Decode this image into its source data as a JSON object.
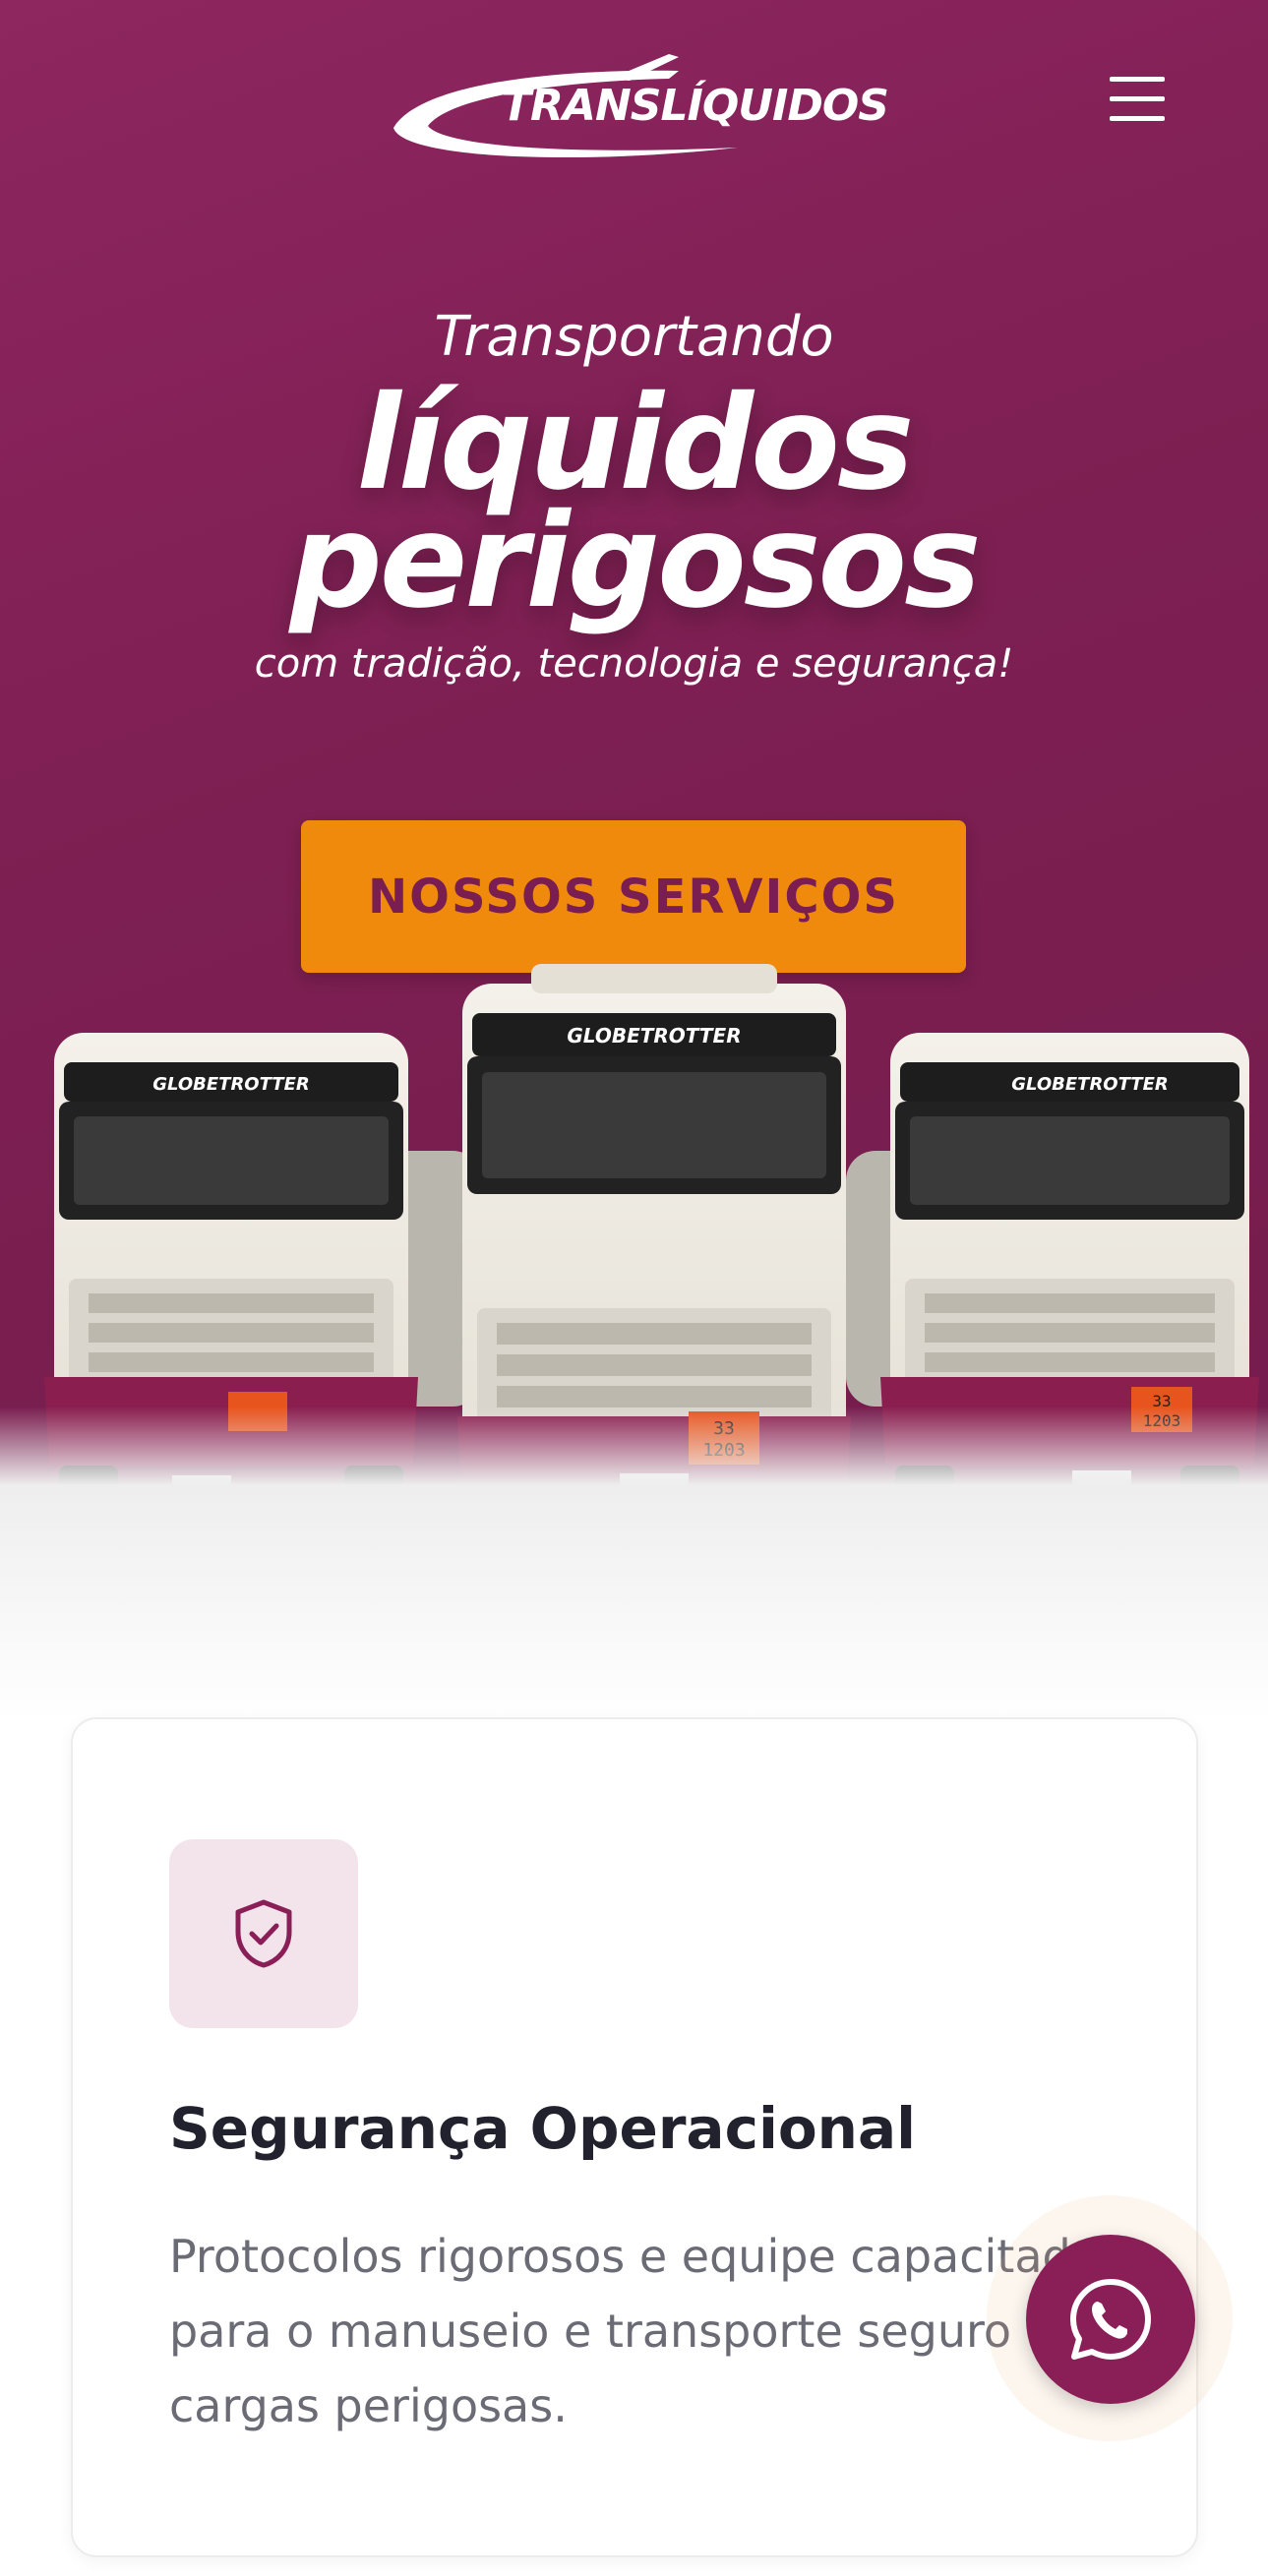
{
  "brand": {
    "name": "TRANSLÍQUIDOS"
  },
  "menu": {
    "icon": "hamburger-menu-icon"
  },
  "hero": {
    "line1": "Transportando",
    "line2": "líquidos",
    "line3": "perigosos",
    "tagline": "com tradição, tecnologia e segurança!",
    "cta_label": "NOSSOS SERVIÇOS"
  },
  "trucks": {
    "left_visor": "GLOBETROTTER",
    "center_visor": "GLOBETROTTER",
    "right_visor": "GLOBETROTTER",
    "hazard_top": "33",
    "hazard_bottom": "1203"
  },
  "feature_card": {
    "icon": "shield-check-icon",
    "title": "Segurança Operacional",
    "description": "Protocolos rigorosos e equipe capacitada para o manuseio e transporte seguro de cargas perigosas."
  },
  "whatsapp": {
    "icon": "whatsapp-icon"
  },
  "colors": {
    "brand_purple": "#7d1f52",
    "cta_orange": "#f08a0c",
    "icon_bg": "#f3e4ec",
    "title_dark": "#22222e",
    "text_gray": "#6b6b76"
  }
}
